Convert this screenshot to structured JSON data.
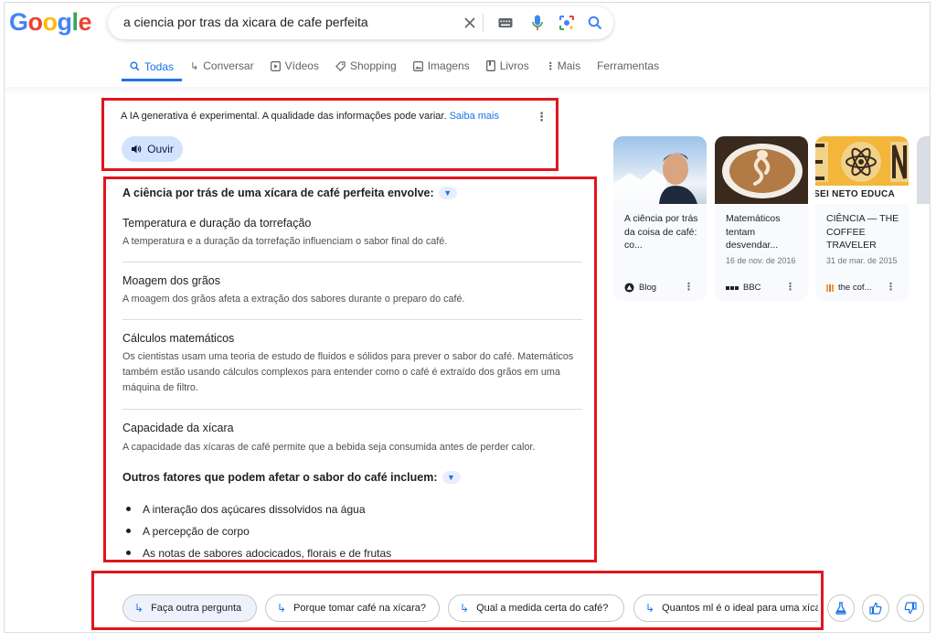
{
  "logo": {
    "text": "Google",
    "letters": [
      {
        "ch": "G",
        "color": "#4285f4"
      },
      {
        "ch": "o",
        "color": "#ea4335"
      },
      {
        "ch": "o",
        "color": "#fbbc05"
      },
      {
        "ch": "g",
        "color": "#4285f4"
      },
      {
        "ch": "l",
        "color": "#34a853"
      },
      {
        "ch": "e",
        "color": "#ea4335"
      }
    ]
  },
  "search": {
    "query": "a ciencia por tras da xicara de cafe perfeita"
  },
  "tabs": [
    {
      "label": "Todas",
      "icon": "search-icon"
    },
    {
      "label": "Conversar",
      "icon": "reply-arrow-icon"
    },
    {
      "label": "Vídeos",
      "icon": "play-icon"
    },
    {
      "label": "Shopping",
      "icon": "tag-icon"
    },
    {
      "label": "Imagens",
      "icon": "image-icon"
    },
    {
      "label": "Livros",
      "icon": "book-icon"
    },
    {
      "label": "Mais",
      "icon": "more-vert-icon"
    },
    {
      "label": "Ferramentas",
      "icon": ""
    }
  ],
  "ai": {
    "disclaimer": "A IA generativa é experimental. A qualidade das informações pode variar.",
    "learn_more": "Saiba mais",
    "listen_label": "Ouvir",
    "heading1": "A ciência por trás de uma xícara de café perfeita envolve:",
    "items": [
      {
        "title": "Temperatura e duração da torrefação",
        "desc": "A temperatura e a duração da torrefação influenciam o sabor final do café."
      },
      {
        "title": "Moagem dos grãos",
        "desc": "A moagem dos grãos afeta a extração dos sabores durante o preparo do café."
      },
      {
        "title": "Cálculos matemáticos",
        "desc": "Os cientistas usam uma teoria de estudo de fluidos e sólidos para prever o sabor do café. Matemáticos também estão usando cálculos complexos para entender como o café é extraído dos grãos em uma máquina de filtro."
      },
      {
        "title": "Capacidade da xícara",
        "desc": "A capacidade das xícaras de café permite que a bebida seja consumida antes de perder calor."
      }
    ],
    "heading2": "Outros fatores que podem afetar o sabor do café incluem:",
    "bullets": [
      "A interação dos açúcares dissolvidos na água",
      "A percepção de corpo",
      "As notas de sabores adocicados, florais e de frutas"
    ]
  },
  "cards": [
    {
      "title": "A ciência por trás da coisa de café: co...",
      "date": "",
      "source": "Blog",
      "source_icon": "blog-logo-icon"
    },
    {
      "title": "Matemáticos tentam desvendar...",
      "date": "16 de nov. de 2016",
      "source": "BBC",
      "source_icon": "bbc-logo-icon"
    },
    {
      "title": "CIÊNCIA — THE COFFEE TRAVELER",
      "date": "31 de mar. de 2015",
      "source": "the cof...",
      "source_icon": "coffee-traveler-logo-icon",
      "thumb_text": "SEI NETO EDUCA"
    }
  ],
  "followups": [
    "Faça outra pergunta",
    "Porque tomar café na xícara?",
    "Qual a medida certa do café?",
    "Quantos ml é o ideal para uma xícara"
  ],
  "colors": {
    "accent": "#1a73e8",
    "highlight": "#e0161d",
    "chip_bg": "#d3e3fd"
  }
}
